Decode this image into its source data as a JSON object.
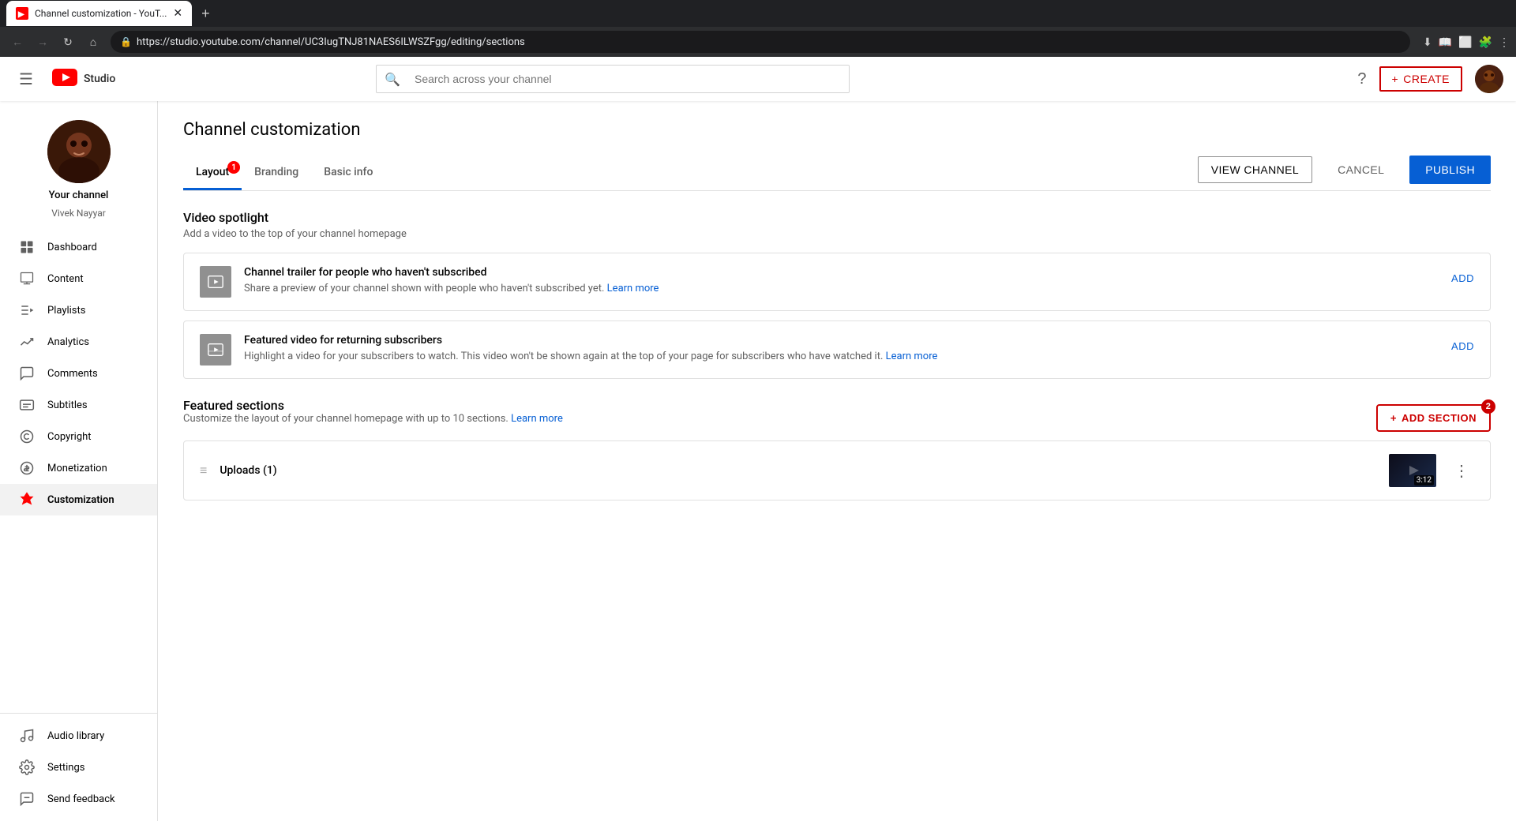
{
  "browser": {
    "tab_title": "Channel customization - YouT...",
    "url": "https://studio.youtube.com/channel/UC3IugTNJ81NAES6ILWSZFgg/editing/sections",
    "new_tab_label": "+"
  },
  "header": {
    "menu_icon": "☰",
    "logo_text": "Studio",
    "search_placeholder": "Search across your channel",
    "create_label": "CREATE",
    "help_icon": "?",
    "create_icon": "+"
  },
  "sidebar": {
    "channel_name": "Your channel",
    "channel_handle": "Vivek Nayyar",
    "nav_items": [
      {
        "id": "dashboard",
        "label": "Dashboard",
        "icon": "grid"
      },
      {
        "id": "content",
        "label": "Content",
        "icon": "content"
      },
      {
        "id": "playlists",
        "label": "Playlists",
        "icon": "playlists"
      },
      {
        "id": "analytics",
        "label": "Analytics",
        "icon": "analytics"
      },
      {
        "id": "comments",
        "label": "Comments",
        "icon": "comments"
      },
      {
        "id": "subtitles",
        "label": "Subtitles",
        "icon": "subtitles"
      },
      {
        "id": "copyright",
        "label": "Copyright",
        "icon": "copyright"
      },
      {
        "id": "monetization",
        "label": "Monetization",
        "icon": "monetization"
      },
      {
        "id": "customization",
        "label": "Customization",
        "icon": "customization",
        "active": true
      }
    ],
    "bottom_items": [
      {
        "id": "audio-library",
        "label": "Audio library",
        "icon": "audio"
      },
      {
        "id": "settings",
        "label": "Settings",
        "icon": "settings"
      },
      {
        "id": "send-feedback",
        "label": "Send feedback",
        "icon": "feedback"
      }
    ]
  },
  "page": {
    "title": "Channel customization",
    "tabs": [
      {
        "id": "layout",
        "label": "Layout",
        "active": true,
        "badge": "1"
      },
      {
        "id": "branding",
        "label": "Branding",
        "active": false,
        "badge": null
      },
      {
        "id": "basic-info",
        "label": "Basic info",
        "active": false,
        "badge": null
      }
    ],
    "actions": {
      "view_channel": "VIEW CHANNEL",
      "cancel": "CANCEL",
      "publish": "PUBLISH"
    },
    "video_spotlight": {
      "title": "Video spotlight",
      "subtitle": "Add a video to the top of your channel homepage",
      "channel_trailer": {
        "title": "Channel trailer for people who haven't subscribed",
        "description": "Share a preview of your channel shown with people who haven't subscribed yet.",
        "link_text": "Learn more",
        "action": "ADD"
      },
      "featured_video": {
        "title": "Featured video for returning subscribers",
        "description": "Highlight a video for your subscribers to watch. This video won't be shown again at the top of your page for subscribers who have watched it.",
        "link_text": "Learn more",
        "action": "ADD"
      }
    },
    "featured_sections": {
      "title": "Featured sections",
      "subtitle": "Customize the layout of your channel homepage with up to 10 sections.",
      "link_text": "Learn more",
      "add_section_label": "ADD SECTION",
      "add_section_badge": "2",
      "uploads": {
        "title": "Uploads (1)",
        "duration": "3:12"
      }
    }
  }
}
